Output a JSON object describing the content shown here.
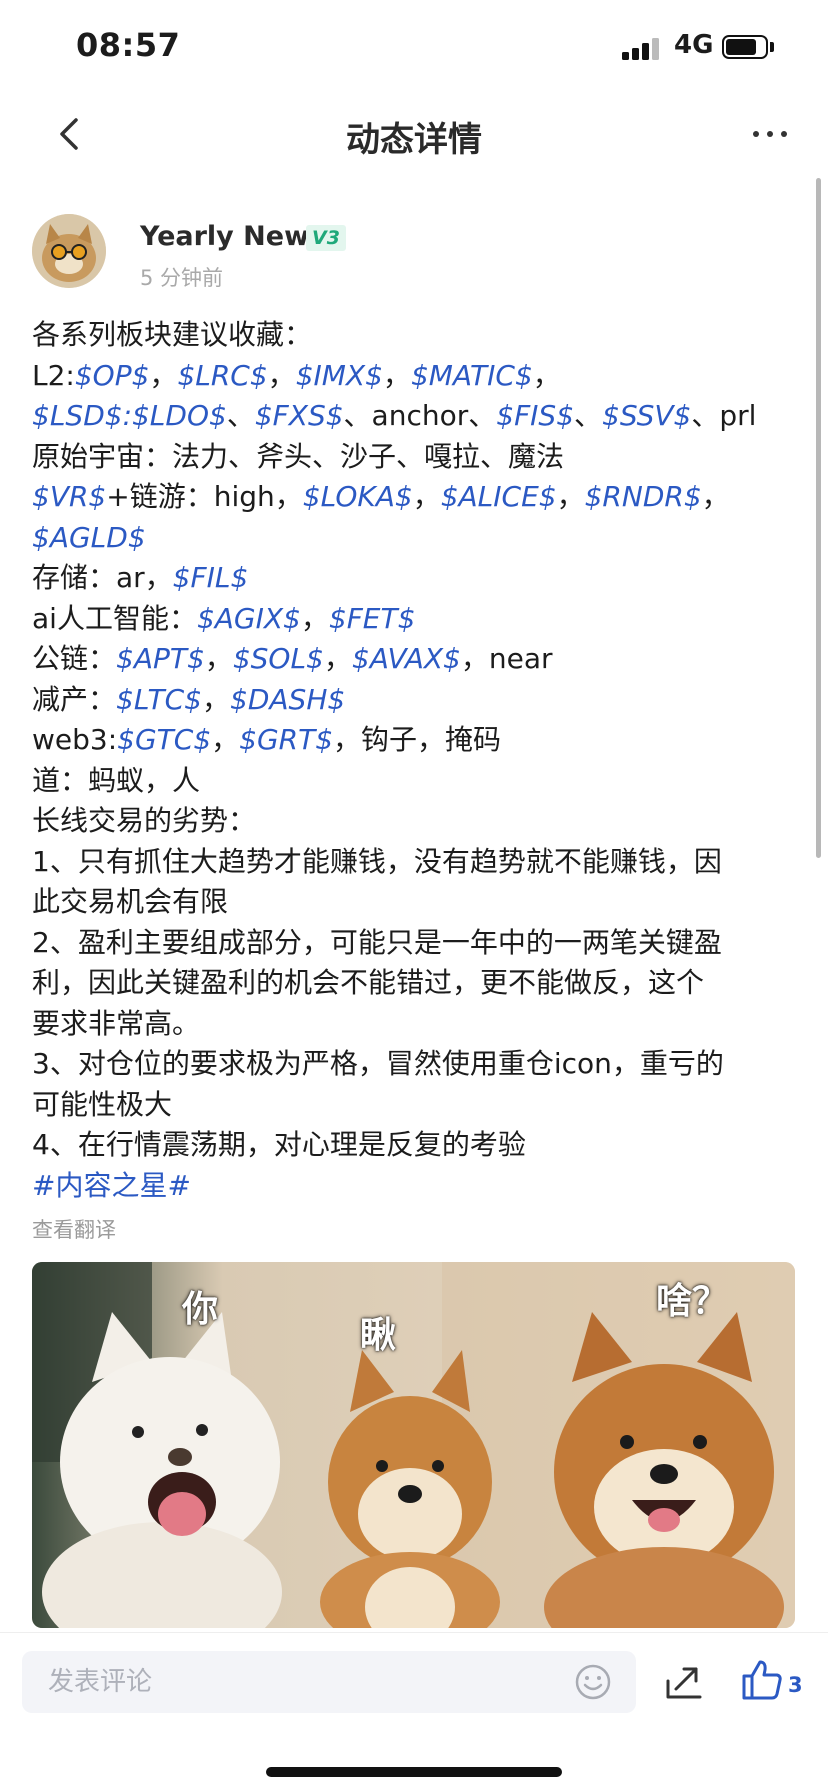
{
  "status_bar": {
    "time": "08:57",
    "network": "4G"
  },
  "nav": {
    "title": "动态详情"
  },
  "author": {
    "name": "Yearly News",
    "badge": "V3",
    "time_ago": "5 分钟前"
  },
  "post": {
    "lines": [
      [
        {
          "t": "各系列板块建议收藏："
        }
      ],
      [
        {
          "t": "L2:"
        },
        {
          "t": "$OP$",
          "k": 1
        },
        {
          "t": "，"
        },
        {
          "t": "$LRC$",
          "k": 1
        },
        {
          "t": "，"
        },
        {
          "t": "$IMX$",
          "k": 1
        },
        {
          "t": "，"
        },
        {
          "t": "$MATIC$",
          "k": 1
        },
        {
          "t": "，"
        }
      ],
      [
        {
          "t": "$LSD$:$LDO$",
          "k": 1
        },
        {
          "t": "、"
        },
        {
          "t": "$FXS$",
          "k": 1
        },
        {
          "t": "、anchor、"
        },
        {
          "t": "$FIS$",
          "k": 1
        },
        {
          "t": "、"
        },
        {
          "t": "$SSV$",
          "k": 1
        },
        {
          "t": "、prl"
        }
      ],
      [
        {
          "t": "原始宇宙：法力、斧头、沙子、嘎拉、魔法"
        }
      ],
      [
        {
          "t": "$VR$",
          "k": 1
        },
        {
          "t": "+链游：high，"
        },
        {
          "t": "$LOKA$",
          "k": 1
        },
        {
          "t": "，"
        },
        {
          "t": "$ALICE$",
          "k": 1
        },
        {
          "t": "，"
        },
        {
          "t": "$RNDR$",
          "k": 1
        },
        {
          "t": "，"
        }
      ],
      [
        {
          "t": "$AGLD$",
          "k": 1
        }
      ],
      [
        {
          "t": "存储：ar，"
        },
        {
          "t": "$FIL$",
          "k": 1
        }
      ],
      [
        {
          "t": "ai人工智能："
        },
        {
          "t": "$AGIX$",
          "k": 1
        },
        {
          "t": "，"
        },
        {
          "t": "$FET$",
          "k": 1
        }
      ],
      [
        {
          "t": "公链："
        },
        {
          "t": "$APT$",
          "k": 1
        },
        {
          "t": "，"
        },
        {
          "t": "$SOL$",
          "k": 1
        },
        {
          "t": "，"
        },
        {
          "t": "$AVAX$",
          "k": 1
        },
        {
          "t": "，near"
        }
      ],
      [
        {
          "t": "减产："
        },
        {
          "t": "$LTC$",
          "k": 1
        },
        {
          "t": "，"
        },
        {
          "t": "$DASH$",
          "k": 1
        }
      ],
      [
        {
          "t": "web3:"
        },
        {
          "t": "$GTC$",
          "k": 1
        },
        {
          "t": "，"
        },
        {
          "t": "$GRT$",
          "k": 1
        },
        {
          "t": "，钩子，掩码"
        }
      ],
      [
        {
          "t": "道：蚂蚁，人"
        }
      ],
      [
        {
          "t": "长线交易的劣势："
        }
      ],
      [
        {
          "t": "1、只有抓住大趋势才能赚钱，没有趋势就不能赚钱，因"
        }
      ],
      [
        {
          "t": "此交易机会有限"
        }
      ],
      [
        {
          "t": "2、盈利主要组成部分，可能只是一年中的一两笔关键盈"
        }
      ],
      [
        {
          "t": "利，因此关键盈利的机会不能错过，更不能做反，这个"
        }
      ],
      [
        {
          "t": "要求非常高。"
        }
      ],
      [
        {
          "t": "3、对仓位的要求极为严格，冒然使用重仓icon，重亏的"
        }
      ],
      [
        {
          "t": "可能性极大"
        }
      ],
      [
        {
          "t": "4、在行情震荡期，对心理是反复的考验"
        }
      ],
      [
        {
          "t": "#内容之星#",
          "h": 1
        }
      ]
    ],
    "translate_label": "查看翻译",
    "image_captions": [
      "你",
      "瞅",
      "啥？"
    ]
  },
  "bottom_bar": {
    "comment_placeholder": "发表评论",
    "like_count": "3"
  },
  "colors": {
    "link": "#2b59c3",
    "badge_text": "#1fa87a",
    "badge_bg": "#e3f6ee"
  }
}
